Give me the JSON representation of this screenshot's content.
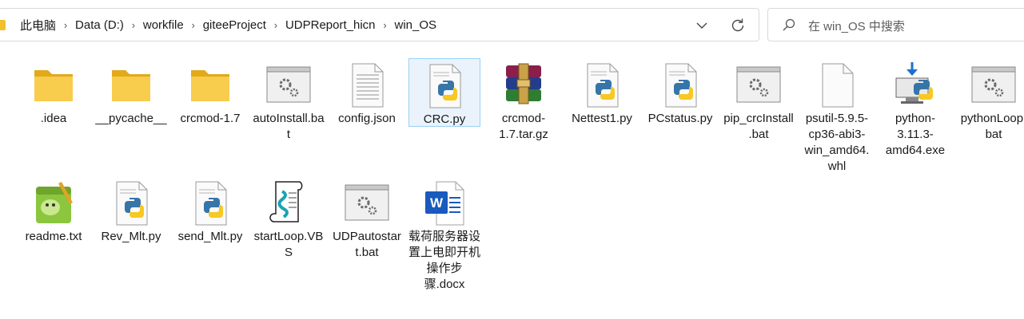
{
  "breadcrumb": [
    "此电脑",
    "Data (D:)",
    "workfile",
    "giteeProject",
    "UDPReport_hicn",
    "win_OS"
  ],
  "search": {
    "placeholder": "在 win_OS 中搜索"
  },
  "files": [
    {
      "name": ".idea",
      "icon": "folder-icon"
    },
    {
      "name": "__pycache__",
      "icon": "folder-icon"
    },
    {
      "name": "crcmod-1.7",
      "icon": "folder-icon"
    },
    {
      "name": "autoInstall.bat",
      "icon": "batch-file-icon"
    },
    {
      "name": "config.json",
      "icon": "text-file-icon"
    },
    {
      "name": "CRC.py",
      "icon": "python-file-icon",
      "selected": true
    },
    {
      "name": "crcmod-1.7.tar.gz",
      "icon": "winrar-archive-icon"
    },
    {
      "name": "Nettest1.py",
      "icon": "python-file-icon"
    },
    {
      "name": "PCstatus.py",
      "icon": "python-file-icon"
    },
    {
      "name": "pip_crcInstall.bat",
      "icon": "batch-file-icon"
    },
    {
      "name": "psutil-5.9.5-cp36-abi3-win_amd64.whl",
      "icon": "blank-file-icon"
    },
    {
      "name": "python-3.11.3-amd64.exe",
      "icon": "python-installer-icon"
    },
    {
      "name": "pythonLoop.bat",
      "icon": "batch-file-icon"
    },
    {
      "name": "readme.txt",
      "icon": "notepad-plus-icon"
    },
    {
      "name": "Rev_Mlt.py",
      "icon": "python-file-icon"
    },
    {
      "name": "send_Mlt.py",
      "icon": "python-file-icon"
    },
    {
      "name": "startLoop.VBS",
      "icon": "vbs-script-icon"
    },
    {
      "name": "UDPautostart.bat",
      "icon": "batch-file-icon"
    },
    {
      "name": "载荷服务器设置上电即开机操作步骤.docx",
      "icon": "word-doc-icon"
    }
  ],
  "colors": {
    "folder": "#f3c02d",
    "selection_bg": "#eaf3fb",
    "selection_border": "#99d1f3",
    "python_blue": "#3775a9",
    "python_yellow": "#f8c823",
    "word_blue": "#185abd"
  }
}
